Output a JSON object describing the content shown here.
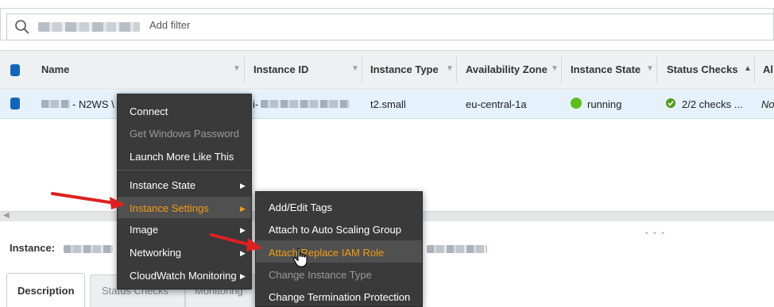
{
  "filter": {
    "add_filter_label": "Add filter"
  },
  "table": {
    "columns": [
      {
        "key": "name",
        "label": "Name"
      },
      {
        "key": "instance_id",
        "label": "Instance ID"
      },
      {
        "key": "instance_type",
        "label": "Instance Type"
      },
      {
        "key": "availability_zone",
        "label": "Availability Zone"
      },
      {
        "key": "instance_state",
        "label": "Instance State"
      },
      {
        "key": "status_checks",
        "label": "Status Checks"
      },
      {
        "key": "alarm_status",
        "label": "Al"
      }
    ],
    "rows": [
      {
        "name_suffix": "- N2WS \\",
        "instance_id_prefix": "i-",
        "instance_type": "t2.small",
        "availability_zone": "eu-central-1a",
        "instance_state": "running",
        "status_checks": "2/2 checks ...",
        "alarm_status": "No"
      }
    ]
  },
  "context_menu": {
    "items": [
      {
        "label": "Connect",
        "enabled": true
      },
      {
        "label": "Get Windows Password",
        "enabled": false
      },
      {
        "label": "Launch More Like This",
        "enabled": true
      },
      {
        "label": "Instance State",
        "enabled": true,
        "submenu": true
      },
      {
        "label": "Instance Settings",
        "enabled": true,
        "submenu": true,
        "highlighted": true
      },
      {
        "label": "Image",
        "enabled": true,
        "submenu": true
      },
      {
        "label": "Networking",
        "enabled": true,
        "submenu": true
      },
      {
        "label": "CloudWatch Monitoring",
        "enabled": true,
        "submenu": true
      }
    ]
  },
  "submenu": {
    "items": [
      {
        "label": "Add/Edit Tags",
        "enabled": true
      },
      {
        "label": "Attach to Auto Scaling Group",
        "enabled": true
      },
      {
        "label": "Attach/Replace IAM Role",
        "enabled": true,
        "highlighted": true
      },
      {
        "label": "Change Instance Type",
        "enabled": false
      },
      {
        "label": "Change Termination Protection",
        "enabled": true
      }
    ]
  },
  "details": {
    "instance_label": "Instance:",
    "tabs": [
      {
        "label": "Description",
        "active": true
      },
      {
        "label": "Status Checks",
        "active": false
      },
      {
        "label": "Monitoring",
        "active": false
      }
    ]
  },
  "colors": {
    "accent": "#f39c12",
    "menu_bg": "#3a3a3a",
    "selected_row": "#e5f1fb",
    "running": "#5bbf1a",
    "checkbox": "#1166bb",
    "annotation_arrow": "#e02020"
  },
  "icons": {
    "search": "search-icon",
    "running": "running-status-icon",
    "checks": "check-icon",
    "cursor": "hand-cursor-icon"
  }
}
